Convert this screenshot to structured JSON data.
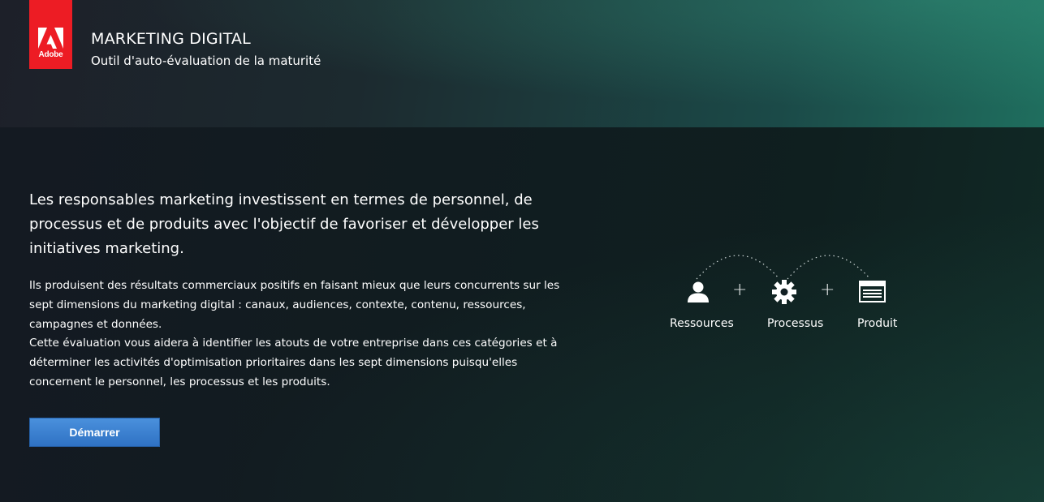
{
  "header": {
    "logo_text": "Adobe",
    "title": "MARKETING DIGITAL",
    "subtitle": "Outil d'auto-évaluation de la maturité"
  },
  "main": {
    "lead": "Les responsables marketing investissent en termes de personnel, de processus et de produits avec l'objectif de favoriser et développer les initiatives marketing.",
    "paragraph_1": "Ils produisent des résultats commerciaux positifs en faisant mieux que leurs concurrents sur les sept dimensions du marketing digital : canaux, audiences, contexte, contenu, ressources, campagnes et données.",
    "paragraph_2": "Cette évaluation vous aidera à identifier les atouts de votre entreprise dans ces catégories et à déterminer les activités d'optimisation prioritaires dans les sept dimensions puisqu'elles concernent le personnel, les processus et les produits.",
    "start_button": "Démarrer"
  },
  "diagram": {
    "items": [
      {
        "label": "Ressources",
        "icon": "person-icon"
      },
      {
        "label": "Processus",
        "icon": "gear-icon"
      },
      {
        "label": "Produit",
        "icon": "browser-window-icon"
      }
    ],
    "separator": "+"
  },
  "colors": {
    "logo_red": "#ed1c24",
    "button_blue": "#3a7fd0"
  }
}
